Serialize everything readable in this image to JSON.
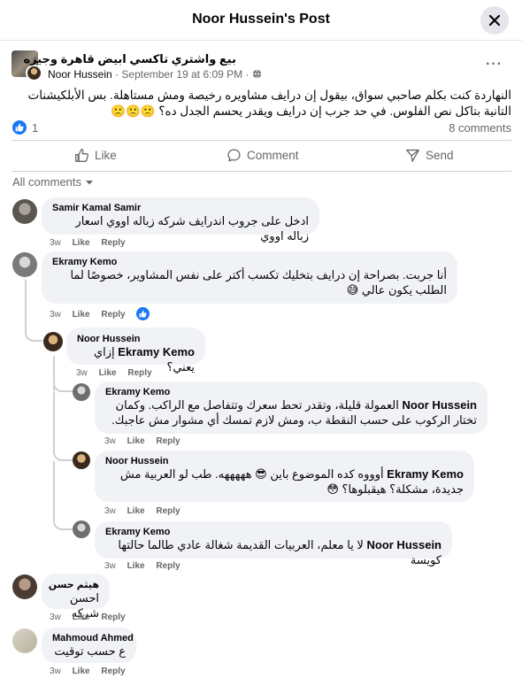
{
  "header": {
    "title": "Noor Hussein's Post"
  },
  "post": {
    "page_name": "بيع واشتري تاكسي ابيض قاهرة وجيزه",
    "author": "Noor Hussein",
    "timestamp": "September 19 at 6:09 PM",
    "privacy_icon": "globe-icon",
    "text": "النهاردة كنت بكلم صاحبي سواق، بيقول إن درايف مشاويره رخيصة ومش مستاهلة. بس الأبلكيشنات التانية بتاكل نص الفلوس. في حد جرب إن درايف ويقدر يحسم الجدل ده؟ 🙁🙁🙁",
    "like_count": "1",
    "comment_count": "8 comments"
  },
  "actions": {
    "like": "Like",
    "comment": "Comment",
    "send": "Send"
  },
  "filter": {
    "label": "All comments"
  },
  "comments": [
    {
      "name": "Samir Kamal Samir",
      "text": "ادخل على جروب اندرايف شركه زباله اووي اسعار زباله اووي",
      "time": "3w",
      "like": "Like",
      "reply": "Reply"
    },
    {
      "name": "Ekramy Kemo",
      "text": "أنا جربت. بصراحة إن درايف بتخليك تكسب أكتر على نفس المشاوير، خصوصًا لما الطلب يكون عالي 😅",
      "time": "3w",
      "like": "Like",
      "reply": "Reply"
    },
    {
      "name": "Noor Hussein",
      "mention": "Ekramy Kemo",
      "text": "إزاي يعني؟",
      "time": "3w",
      "like": "Like",
      "reply": "Reply"
    },
    {
      "name": "Ekramy Kemo",
      "mention": "Noor Hussein",
      "text": "العمولة قليلة، وتقدر تحط سعرك وتتفاصل مع الراكب. وكمان تختار الركوب على حسب النقطة ب، ومش لازم تمسك أي مشوار مش عاجبك.",
      "time": "3w",
      "like": "Like",
      "reply": "Reply"
    },
    {
      "name": "Noor Hussein",
      "mention": "Ekramy Kemo",
      "text": "أوووه كده الموضوع باين 😎 هههههه. طب لو العربية مش جديدة، مشكلة؟ هيقبلوها؟ 😳",
      "time": "3w",
      "like": "Like",
      "reply": "Reply"
    },
    {
      "name": "Ekramy Kemo",
      "mention": "Noor Hussein",
      "text": "لا يا معلم، العربيات القديمة شغالة عادي طالما حالتها كويسة",
      "time": "3w",
      "like": "Like",
      "reply": "Reply"
    },
    {
      "name": "هيثم حسن",
      "text": "احسن شركه",
      "time": "3w",
      "like": "Like",
      "reply": "Reply"
    },
    {
      "name": "Mahmoud Ahmed",
      "text": "ع حسب توقيت",
      "time": "3w",
      "like": "Like",
      "reply": "Reply"
    }
  ]
}
